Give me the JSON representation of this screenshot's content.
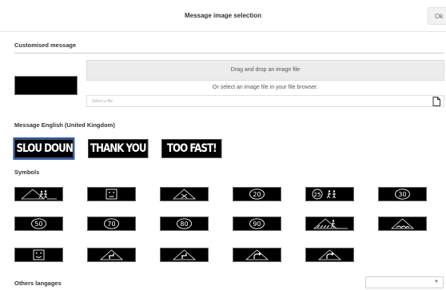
{
  "header": {
    "title": "Message image selection",
    "ok_label": "Ok"
  },
  "customised": {
    "label": "Customised message",
    "drop_text": "Drag and drop an image file",
    "or_text": "Or select an image file in your file browser.",
    "file_placeholder": "Select a file"
  },
  "messages": {
    "label": "Message English (United Kingdom)",
    "items": [
      {
        "text": "SLOU DOUN",
        "selected": true
      },
      {
        "text": "THANK YOU",
        "selected": false
      },
      {
        "text": "TOO FAST!",
        "selected": false
      }
    ]
  },
  "symbols": {
    "label": "Symbols",
    "items": [
      {
        "icon": "children-crossing-icon"
      },
      {
        "icon": "sad-face-icon"
      },
      {
        "icon": "crossroads-warning-icon"
      },
      {
        "icon": "speed-20-icon",
        "text": "20"
      },
      {
        "icon": "speed-25-children-icon",
        "text": "25"
      },
      {
        "icon": "speed-30-icon",
        "text": "30"
      },
      {
        "icon": "speed-50-icon",
        "text": "50"
      },
      {
        "icon": "speed-70-icon",
        "text": "70"
      },
      {
        "icon": "speed-80-icon",
        "text": "80"
      },
      {
        "icon": "speed-90-icon",
        "text": "90"
      },
      {
        "icon": "pedestrian-crossing-icon"
      },
      {
        "icon": "road-bumps-icon"
      },
      {
        "icon": "happy-face-icon"
      },
      {
        "icon": "bend-warning-icon"
      },
      {
        "icon": "bend-warning-icon"
      },
      {
        "icon": "right-bend-warning-icon"
      },
      {
        "icon": "right-bend-warning-icon"
      }
    ]
  },
  "other_languages": {
    "label": "Others langages",
    "selected": ""
  },
  "colors": {
    "selected_outline": "#2f5bb7",
    "sign_background": "#000000",
    "sign_foreground": "#ffffff"
  }
}
